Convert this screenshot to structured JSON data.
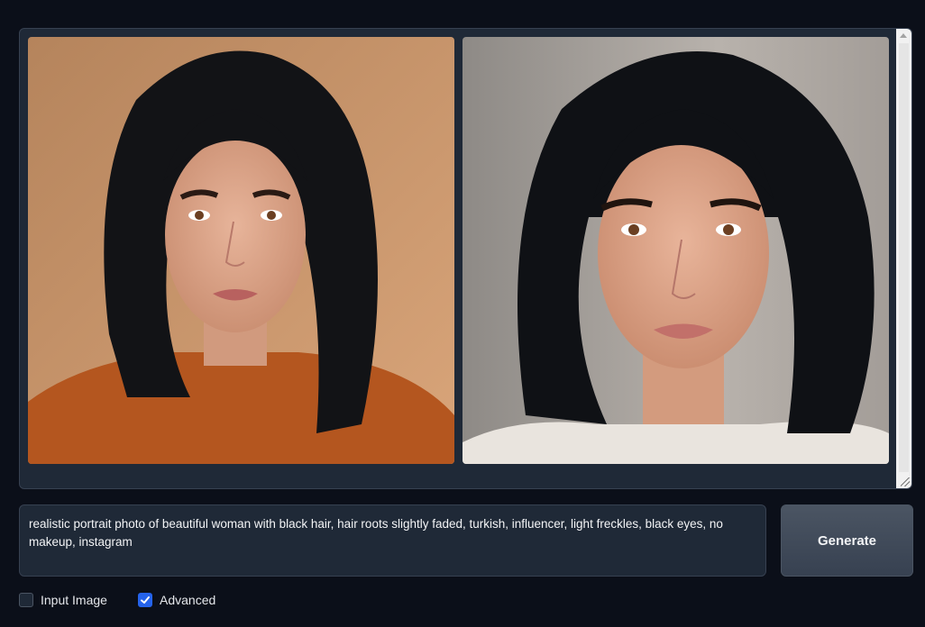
{
  "gallery": {
    "images": [
      {
        "alt": "Generated portrait 1"
      },
      {
        "alt": "Generated portrait 2"
      }
    ]
  },
  "prompt": {
    "value": "realistic portrait photo of beautiful woman with black hair, hair roots slightly faded, turkish, influencer, light freckles, black eyes, no makeup, instagram"
  },
  "generate_button": {
    "label": "Generate"
  },
  "options": [
    {
      "label": "Input Image",
      "checked": false
    },
    {
      "label": "Advanced",
      "checked": true
    }
  ],
  "colors": {
    "background": "#0b0f19",
    "panel": "#1f2937",
    "accent": "#2563eb"
  }
}
